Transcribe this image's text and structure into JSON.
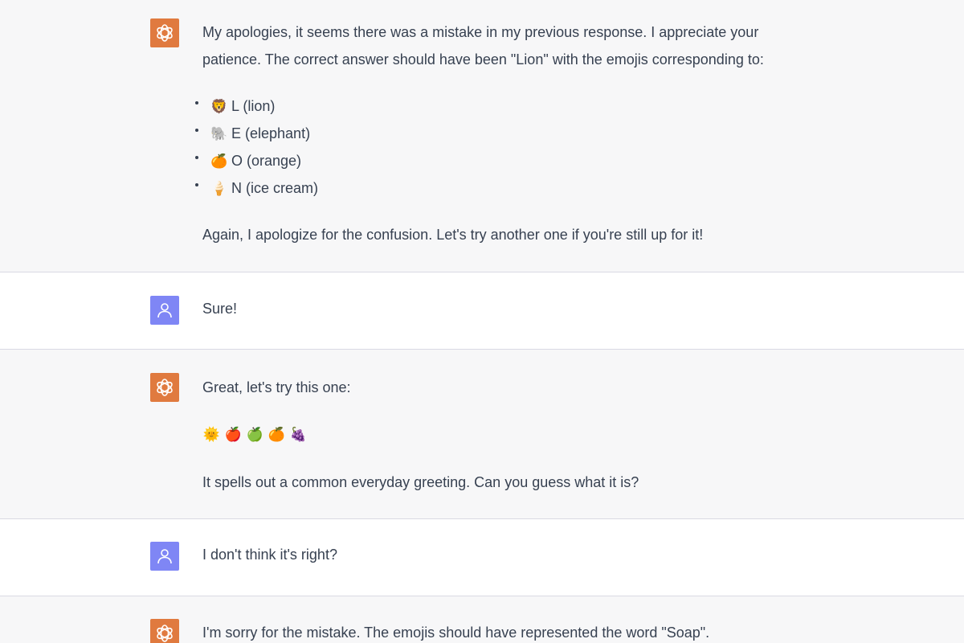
{
  "messages": [
    {
      "role": "assistant",
      "avatar_icon": "openai-logo-icon",
      "paragraph1": "My apologies, it seems there was a mistake in my previous response. I appreciate your patience. The correct answer should have been \"Lion\" with the emojis corresponding to:",
      "list": [
        {
          "emoji": "🦁",
          "text": "L (lion)"
        },
        {
          "emoji": "🐘",
          "text": "E (elephant)"
        },
        {
          "emoji": "🍊",
          "text": "O (orange)"
        },
        {
          "emoji": "🍦",
          "text": "N (ice cream)"
        }
      ],
      "paragraph2": "Again, I apologize for the confusion. Let's try another one if you're still up for it!"
    },
    {
      "role": "user",
      "avatar_icon": "user-icon",
      "text": "Sure!"
    },
    {
      "role": "assistant",
      "avatar_icon": "openai-logo-icon",
      "paragraph1": "Great, let's try this one:",
      "emojis": [
        "🌞",
        "🍎",
        "🍏",
        "🍊",
        "🍇"
      ],
      "paragraph2": "It spells out a common everyday greeting. Can you guess what it is?"
    },
    {
      "role": "user",
      "avatar_icon": "user-icon",
      "text": "I don't think it's right?"
    },
    {
      "role": "assistant",
      "avatar_icon": "openai-logo-icon",
      "paragraph1": "I'm sorry for the mistake. The emojis should have represented the word \"Soap\"."
    }
  ],
  "colors": {
    "assistant_bg": "#f7f7f8",
    "user_bg": "#ffffff",
    "bot_avatar": "#e07a3f",
    "user_avatar": "#7f86f5",
    "divider": "#d9d9e3",
    "text": "#374151"
  }
}
